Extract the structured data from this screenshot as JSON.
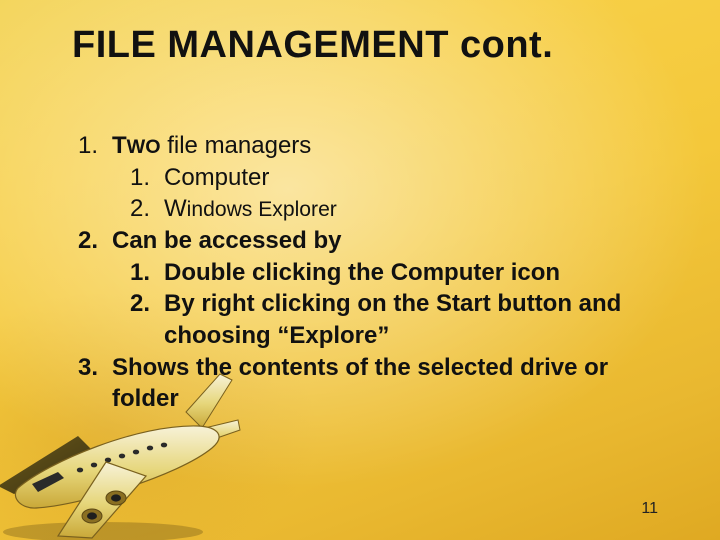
{
  "title": "FILE MANAGEMENT cont.",
  "list": {
    "i1": {
      "n": "1.",
      "t_a": "T",
      "t_b": "WO",
      "t_c": " file managers"
    },
    "i1s1": {
      "n": "1.",
      "t": "Computer"
    },
    "i1s2": {
      "n": "2.",
      "t_a": "W",
      "t_b": "indows Explorer"
    },
    "i2": {
      "n": "2.",
      "t": "Can be accessed by"
    },
    "i2s1": {
      "n": "1.",
      "t": "Double clicking the Computer icon"
    },
    "i2s2": {
      "n": "2.",
      "t": "By right clicking on the Start button and choosing “Explore”"
    },
    "i3": {
      "n": "3.",
      "t": "Shows the contents of the selected drive or folder"
    }
  },
  "page_number": "11",
  "decorative_image": "airplane-illustration"
}
